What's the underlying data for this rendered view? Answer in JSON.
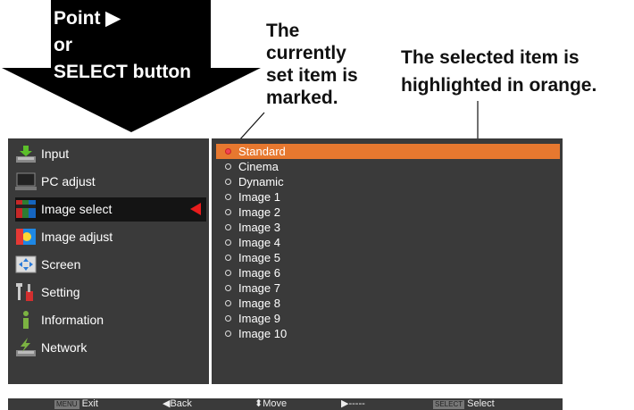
{
  "callouts": {
    "point_line1": "Point ▶",
    "point_line2": "or",
    "point_line3": "SELECT button",
    "marked_line1": "The",
    "marked_line2": "currently",
    "marked_line3": "set item is",
    "marked_line4": "marked.",
    "highlight_line1": "The selected item is",
    "highlight_line2": "highlighted in orange."
  },
  "menu": {
    "items": [
      {
        "label": "Input",
        "icon": "input-icon"
      },
      {
        "label": "PC adjust",
        "icon": "pc-adjust-icon"
      },
      {
        "label": "Image select",
        "icon": "image-select-icon"
      },
      {
        "label": "Image adjust",
        "icon": "image-adjust-icon"
      },
      {
        "label": "Screen",
        "icon": "screen-icon"
      },
      {
        "label": "Setting",
        "icon": "setting-icon"
      },
      {
        "label": "Information",
        "icon": "information-icon"
      },
      {
        "label": "Network",
        "icon": "network-icon"
      }
    ],
    "selected_index": 2
  },
  "image_list": {
    "items": [
      "Standard",
      "Cinema",
      "Dynamic",
      "Image 1",
      "Image 2",
      "Image 3",
      "Image 4",
      "Image 5",
      "Image 6",
      "Image 7",
      "Image 8",
      "Image 9",
      "Image 10"
    ],
    "selected_index": 0
  },
  "footer": {
    "exit_key": "MENU",
    "exit": "Exit",
    "back": "◀Back",
    "move": "⬍Move",
    "next": "▶-----",
    "select_key": "SELECT",
    "select": "Select"
  },
  "colors": {
    "panel": "#3a3a3a",
    "highlight": "#e7782f",
    "pointer": "#e81c1c"
  }
}
